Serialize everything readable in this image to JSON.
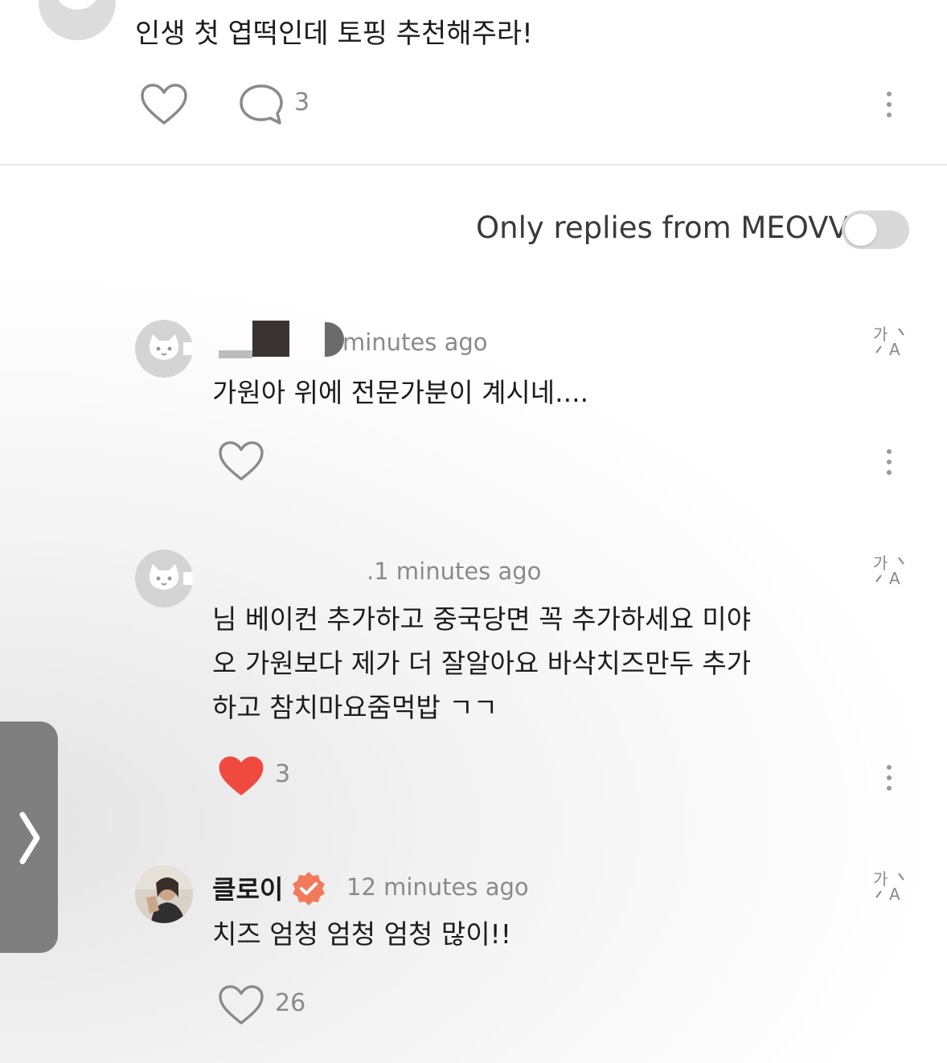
{
  "post": {
    "text": "인생 첫 엽떡인데 토핑 추천해주라!",
    "comment_count": "3"
  },
  "filter": {
    "label": "Only replies from MEOVV",
    "enabled": false
  },
  "replies": [
    {
      "time": "minutes ago",
      "text": "가원아 위에 전문가분이 계시네....",
      "liked": false,
      "like_count": ""
    },
    {
      "time": ".1 minutes ago",
      "text_lines": [
        "님 베이컨 추가하고 중국당면 꼭 추가하세요 미야",
        "오 가원보다 제가 더 잘알아요 바삭치즈만두 추가",
        "하고 참치마요줌먹밥 ㄱㄱ"
      ],
      "liked": true,
      "like_count": "3"
    },
    {
      "username": "클로이",
      "verified": true,
      "time": "12 minutes ago",
      "text": "치즈 엄청 엄청 엄청 많이!!",
      "liked": false,
      "like_count": "26"
    }
  ],
  "icons": {
    "translate": "translate-icon",
    "heart": "heart-icon",
    "comment": "comment-icon",
    "more": "more-vertical-icon",
    "side_tab": "chevron-right-icon"
  },
  "colors": {
    "liked_heart": "#f04a3f",
    "verified_badge": "#f27a5b",
    "toggle_off": "#d9d9d9"
  }
}
